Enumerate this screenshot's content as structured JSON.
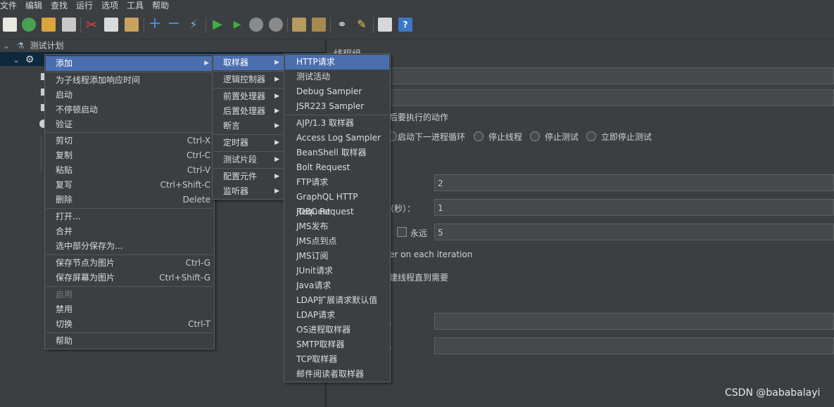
{
  "menubar": [
    "文件",
    "编辑",
    "查找",
    "运行",
    "选项",
    "工具",
    "帮助"
  ],
  "tree": {
    "root_label": "测试计划"
  },
  "right_panel": {
    "title": "线程组",
    "action_section_label": "后要执行的动作",
    "radios": [
      "启动下一进程循环",
      "停止线程",
      "停止测试",
      "立即停止测试"
    ],
    "fields": {
      "threads": "2",
      "ramp_label": "间（秒）：",
      "ramp": "1",
      "forever_label": "永远",
      "loop": "5"
    },
    "same_user_label": "er on each iteration",
    "delay_label": "建线程直到需要",
    "paren1": "）",
    "paren2": "）"
  },
  "context_menu": {
    "items": [
      {
        "label": "添加",
        "shortcut": "",
        "submenu": true,
        "selected": true
      },
      {
        "label": "为子线程添加响应时间",
        "shortcut": ""
      },
      {
        "label": "启动",
        "shortcut": ""
      },
      {
        "label": "不停顿启动",
        "shortcut": ""
      },
      {
        "label": "验证",
        "shortcut": ""
      },
      {
        "label": "剪切",
        "shortcut": "Ctrl-X"
      },
      {
        "label": "复制",
        "shortcut": "Ctrl-C"
      },
      {
        "label": "粘贴",
        "shortcut": "Ctrl-V"
      },
      {
        "label": "复写",
        "shortcut": "Ctrl+Shift-C"
      },
      {
        "label": "删除",
        "shortcut": "Delete"
      },
      {
        "label": "打开...",
        "shortcut": ""
      },
      {
        "label": "合并",
        "shortcut": ""
      },
      {
        "label": "选中部分保存为...",
        "shortcut": ""
      },
      {
        "label": "保存节点为图片",
        "shortcut": "Ctrl-G"
      },
      {
        "label": "保存屏幕为图片",
        "shortcut": "Ctrl+Shift-G"
      },
      {
        "label": "启用",
        "shortcut": "",
        "disabled": true
      },
      {
        "label": "禁用",
        "shortcut": ""
      },
      {
        "label": "切换",
        "shortcut": "Ctrl-T"
      },
      {
        "label": "帮助",
        "shortcut": ""
      }
    ]
  },
  "add_submenu": {
    "items": [
      "取样器",
      "逻辑控制器",
      "前置处理器",
      "后置处理器",
      "断言",
      "定时器",
      "测试片段",
      "配置元件",
      "监听器"
    ]
  },
  "sampler_submenu": {
    "items": [
      "HTTP请求",
      "测试活动",
      "Debug Sampler",
      "JSR223 Sampler",
      "AJP/1.3 取样器",
      "Access Log Sampler",
      "BeanShell 取样器",
      "Bolt Request",
      "FTP请求",
      "GraphQL HTTP Request",
      "JDBC Request",
      "JMS发布",
      "JMS点到点",
      "JMS订阅",
      "JUnit请求",
      "Java请求",
      "LDAP扩展请求默认值",
      "LDAP请求",
      "OS进程取样器",
      "SMTP取样器",
      "TCP取样器",
      "邮件阅读者取样器"
    ]
  },
  "watermark": "CSDN @bababalayi",
  "colors": {
    "background": "#3c3f41",
    "selection": "#4b6eaf",
    "text": "#dcdcdc"
  }
}
